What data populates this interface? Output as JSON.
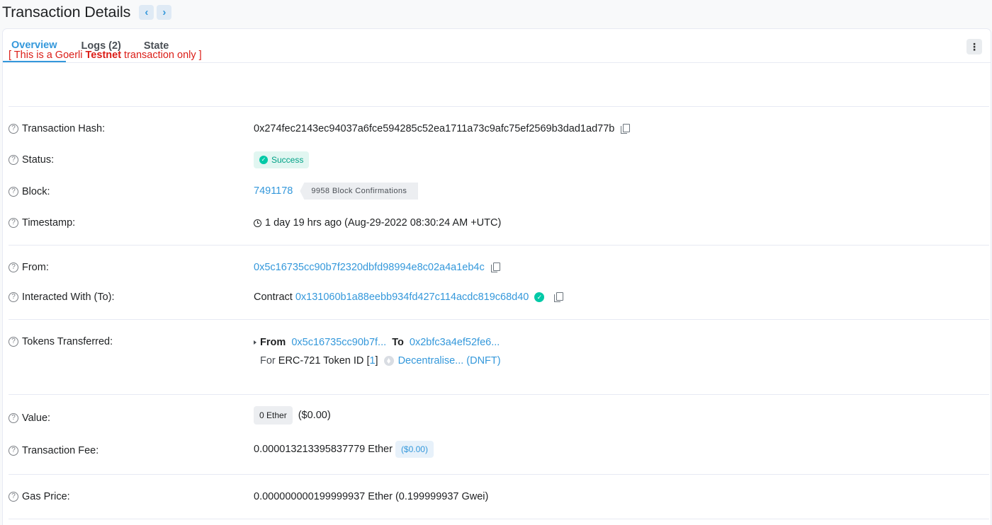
{
  "header": {
    "title": "Transaction Details",
    "prev_label": "‹",
    "next_label": "›"
  },
  "tabs": [
    {
      "label": "Overview",
      "active": true
    },
    {
      "label": "Logs (2)",
      "active": false
    },
    {
      "label": "State",
      "active": false
    }
  ],
  "more_menu_label": "⋮",
  "notice": {
    "prefix": "[ This is a Goerli ",
    "bold": "Testnet",
    "suffix": " transaction only ]"
  },
  "fields": {
    "tx_hash": {
      "label": "Transaction Hash:",
      "value": "0x274fec2143ec94037a6fce594285c52ea1711a73c9afc75ef2569b3dad1ad77b"
    },
    "status": {
      "label": "Status:",
      "value": "Success"
    },
    "block": {
      "label": "Block:",
      "value": "7491178",
      "confirmations": "9958 Block Confirmations"
    },
    "timestamp": {
      "label": "Timestamp:",
      "value": "1 day 19 hrs ago (Aug-29-2022 08:30:24 AM +UTC)"
    },
    "from": {
      "label": "From:",
      "value": "0x5c16735cc90b7f2320dbfd98994e8c02a4a1eb4c"
    },
    "to": {
      "label": "Interacted With (To):",
      "prefix": "Contract",
      "value": "0x131060b1a88eebb934fd427c114acdc819c68d40"
    },
    "tokens": {
      "label": "Tokens Transferred:",
      "from_label": "From",
      "from_value": "0x5c16735cc90b7f...",
      "to_label": "To",
      "to_value": "0x2bfc3a4ef52fe6...",
      "for_label": "For",
      "token_type": "ERC-721 Token ID",
      "token_id_open": "[",
      "token_id": "1",
      "token_id_close": "]",
      "token_name": "Decentralise... (DNFT)"
    },
    "value": {
      "label": "Value:",
      "amount": "0 Ether",
      "usd": "($0.00)"
    },
    "fee": {
      "label": "Transaction Fee:",
      "amount": "0.000013213395837779 Ether",
      "usd": "($0.00)"
    },
    "gas_price": {
      "label": "Gas Price:",
      "value": "0.000000000199999937 Ether (0.199999937 Gwei)"
    }
  },
  "help_icon_glyph": "?",
  "colors": {
    "accent": "#3498db",
    "success": "#00c9a7",
    "testnet_red": "#db1d17"
  }
}
